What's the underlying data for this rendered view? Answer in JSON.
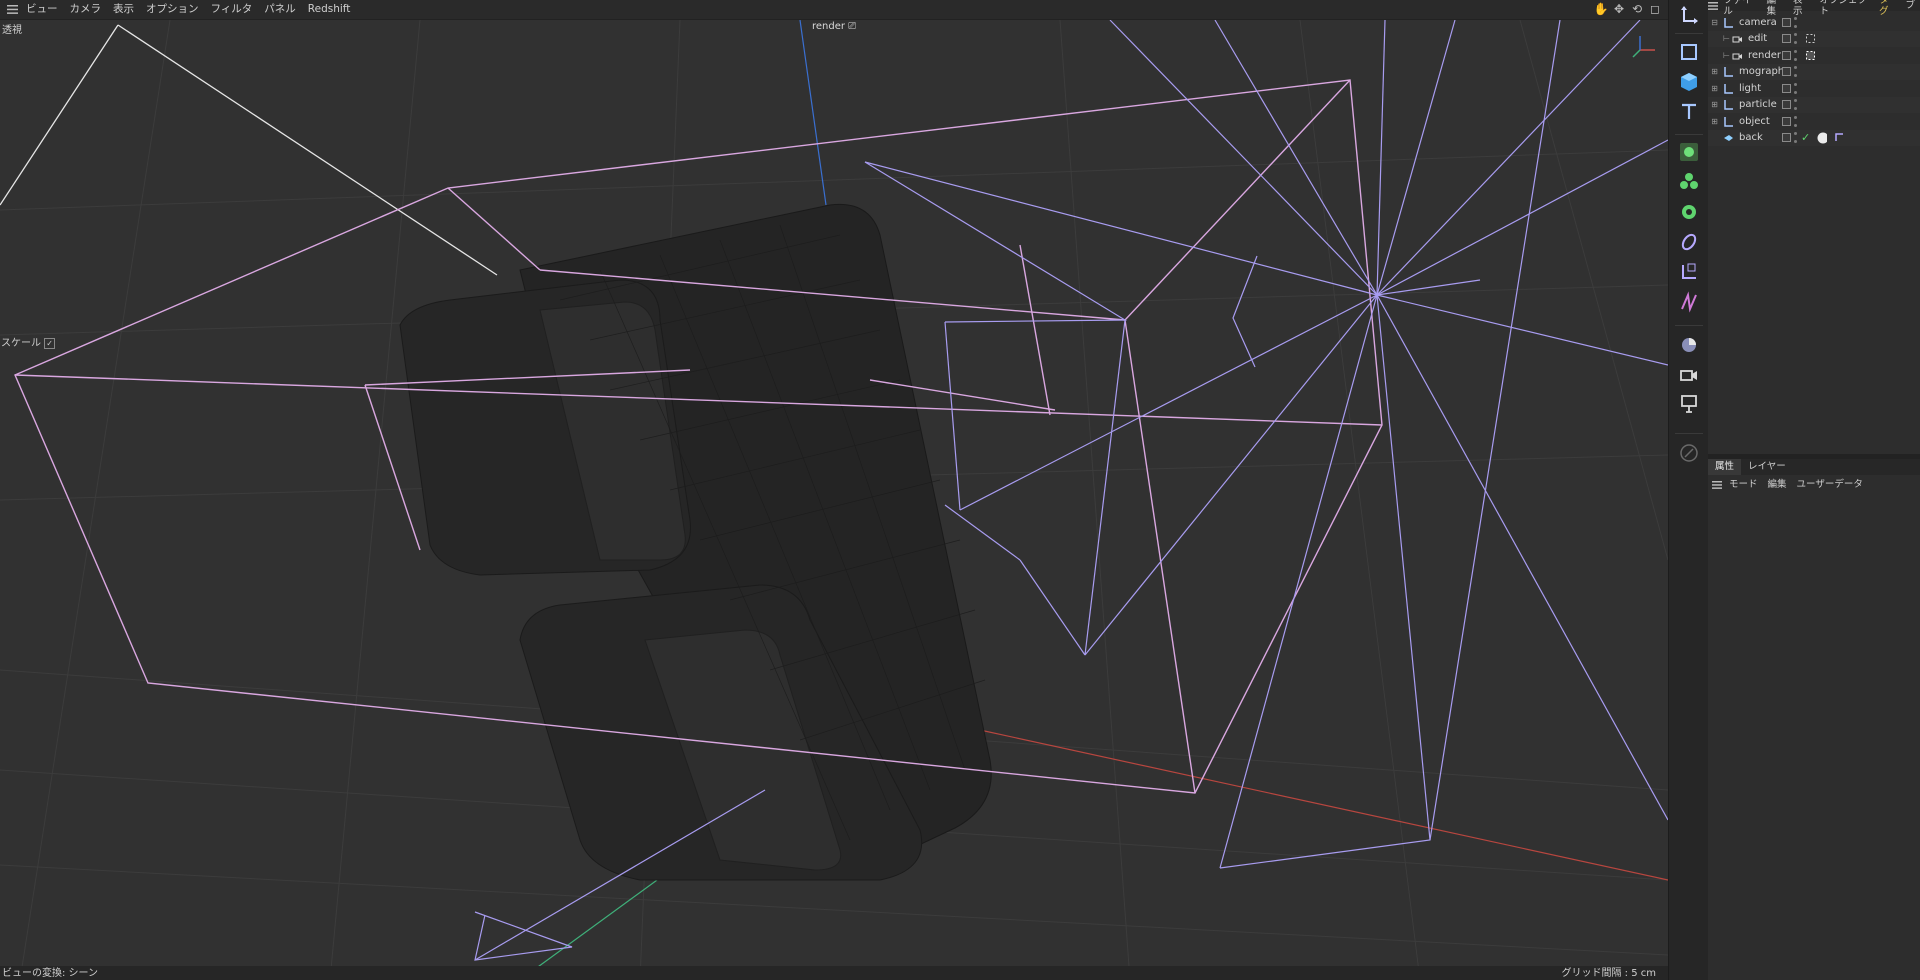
{
  "viewport": {
    "menu": [
      "ビュー",
      "カメラ",
      "表示",
      "オプション",
      "フィルタ",
      "パネル",
      "Redshift"
    ],
    "projection_label": "透視",
    "camera_tag": "render",
    "scale_label": "スケール",
    "status_left": "ビューの変換: シーン",
    "status_right": "グリッド間隔 : 5 cm",
    "axis_labels": {
      "x": "X",
      "y": "Y",
      "z": "Z"
    }
  },
  "toolbar": {
    "tools": [
      "move-tool-icon",
      "cube-outline-icon",
      "cube-icon",
      "text-icon",
      "cloner-icon",
      "mograph-icon",
      "gear-icon",
      "deformer-icon",
      "field-icon",
      "spline-icon",
      "scene-icon",
      "camera-icon",
      "render-icon",
      "brush-icon"
    ]
  },
  "object_manager": {
    "menu": [
      "ファイル",
      "編集",
      "表示",
      "オブジェクト",
      "タグ",
      "ブ"
    ],
    "objects": [
      {
        "name": "camera",
        "type": "null",
        "level": 0,
        "expanded": true
      },
      {
        "name": "edit",
        "type": "camera",
        "level": 1,
        "tag": "target"
      },
      {
        "name": "render",
        "type": "camera",
        "level": 1,
        "tag": "target-active"
      },
      {
        "name": "mograph",
        "type": "null",
        "level": 0
      },
      {
        "name": "light",
        "type": "null",
        "level": 0
      },
      {
        "name": "particle",
        "type": "null",
        "level": 0
      },
      {
        "name": "object",
        "type": "null",
        "level": 0
      },
      {
        "name": "back",
        "type": "plane",
        "level": 0,
        "tag": "material"
      }
    ]
  },
  "attributes": {
    "tabs": [
      "属性",
      "レイヤー"
    ],
    "active_tab": "属性",
    "menu": [
      "モード",
      "編集",
      "ユーザーデータ"
    ]
  },
  "colors": {
    "viewport_bg": "#313131",
    "camera_frustum": "#d9a7e0",
    "light_rays": "#a89cf0",
    "axis_x": "#c8504a",
    "axis_y": "#3fb07a",
    "axis_z": "#3a6fd0"
  }
}
